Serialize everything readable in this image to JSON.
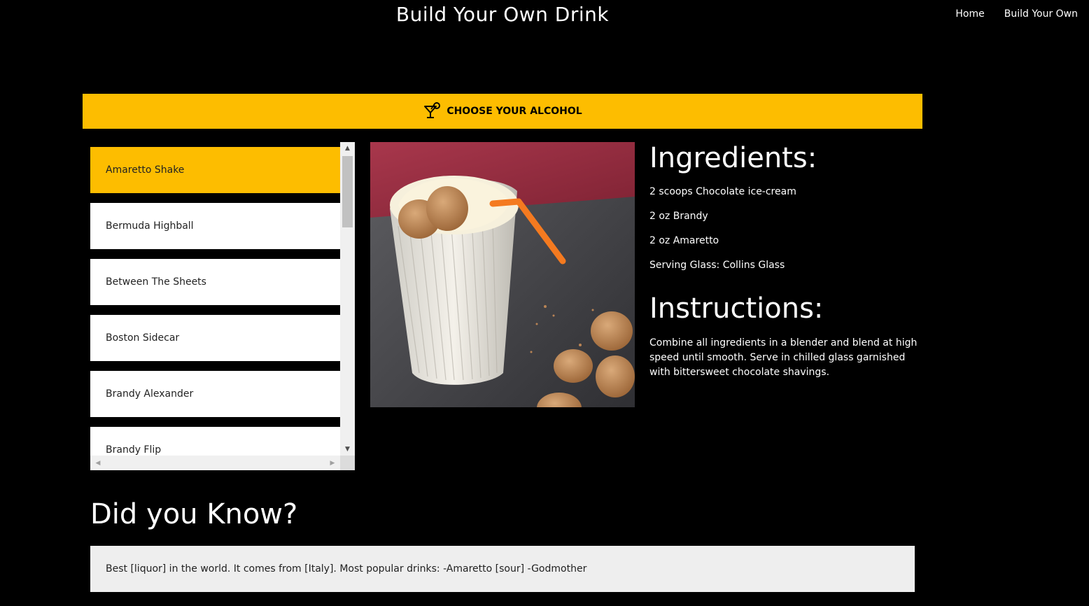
{
  "header": {
    "title": "Build Your Own Drink",
    "nav": [
      "Home",
      "Build Your Own"
    ]
  },
  "choose_bar": {
    "label": "CHOOSE YOUR ALCOHOL",
    "icon": "cocktail-glass-icon"
  },
  "drinks": {
    "selected": "Amaretto Shake",
    "items": [
      "Amaretto Shake",
      "Bermuda Highball",
      "Between The Sheets",
      "Boston Sidecar",
      "Brandy Alexander",
      "Brandy Flip"
    ]
  },
  "details": {
    "ingredients_title": "Ingredients:",
    "ingredients": [
      "2 scoops Chocolate ice-cream",
      "2 oz Brandy",
      "2 oz Amaretto",
      "Serving Glass: Collins Glass"
    ],
    "instructions_title": "Instructions:",
    "instructions": "Combine all ingredients in a blender and blend at high speed until smooth. Serve in chilled glass garnished with bittersweet chocolate shavings."
  },
  "did_you_know": {
    "title": "Did you Know?",
    "fact": "Best [liquor] in the world. It comes from [Italy]. Most popular drinks: -Amaretto [sour] -Godmother"
  },
  "colors": {
    "background": "#000000",
    "accent": "#fdbd00",
    "fact_box": "#eeeeee"
  }
}
